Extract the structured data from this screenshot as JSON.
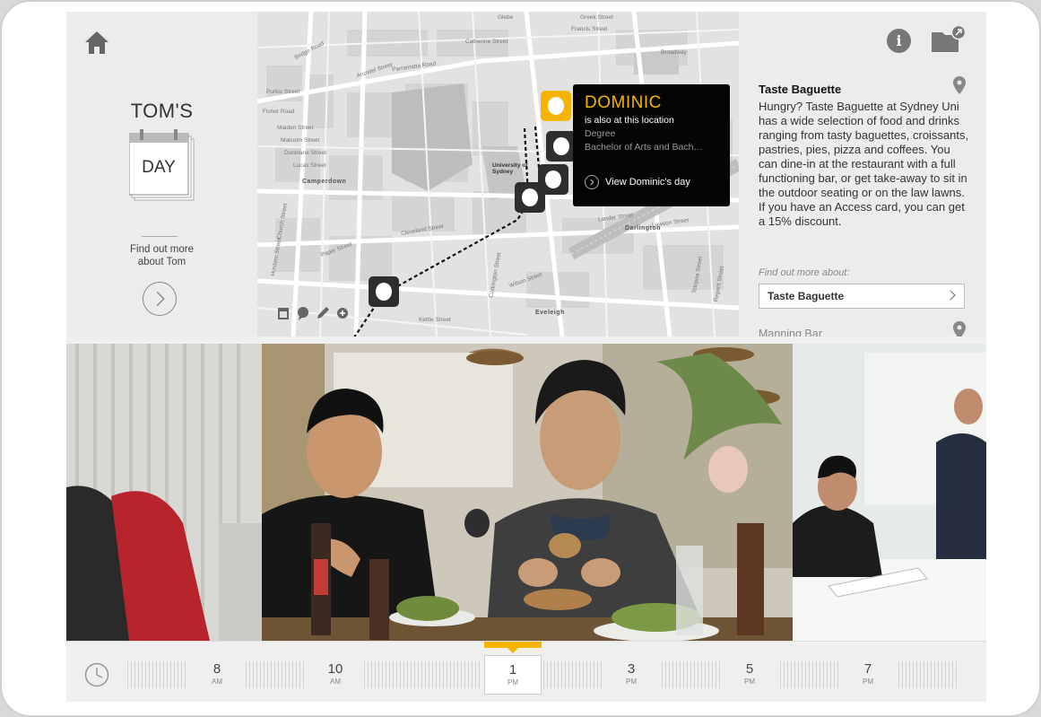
{
  "left_panel": {
    "title": "TOM'S",
    "calendar_label": "DAY",
    "find_more_line1": "Find out more",
    "find_more_line2": "about Tom"
  },
  "map": {
    "streets": [
      "Glebe",
      "Greek Street",
      "Francis Street",
      "Catherine Street",
      "Bridge Road",
      "Parramatta Road",
      "Broadway",
      "Arundel Street",
      "Purkis Street",
      "Fisher Road",
      "Maiden Street",
      "Malcolm Street",
      "Dunblane Street",
      "Lucas Street",
      "Church Street",
      "Hordern Street",
      "Paper Street",
      "Cleveland Street",
      "Lander Street",
      "Lawson Street",
      "Wilson Street",
      "Codrington Street",
      "Kettle Street",
      "Telopea Street",
      "Regent Street",
      "Eveleigh",
      "Darlington",
      "Camperdown",
      "University of Sydney"
    ],
    "tools": [
      "calendar-tool-icon",
      "chat-tool-icon",
      "pencil-tool-icon",
      "add-tool-icon"
    ]
  },
  "popup": {
    "name": "DOMINIC",
    "subtitle": "is also at this location",
    "degree_label": "Degree",
    "degree_value": "Bachelor of Arts and Bach…",
    "link_label": "View Dominic's day"
  },
  "right_panel": {
    "place_title": "Taste Baguette",
    "place_description": "Hungry? Taste Baguette at Sydney Uni has a wide selection of food and drinks ranging from tasty baguettes, croissants, pastries, pies, pizza and coffees. You can dine-in at the restaurant with a full functioning bar, or get take-away to sit in the outdoor seating or on the law lawns. If you have an Access card, you can get a 15% discount.",
    "find_about_label": "Find out more about:",
    "find_about_button": "Taste Baguette",
    "next_place": "Manning Bar"
  },
  "timeline": {
    "ticks": [
      {
        "hour": "8",
        "period": "AM"
      },
      {
        "hour": "10",
        "period": "AM"
      },
      {
        "hour": "1",
        "period": "PM"
      },
      {
        "hour": "3",
        "period": "PM"
      },
      {
        "hour": "5",
        "period": "PM"
      },
      {
        "hour": "7",
        "period": "PM"
      }
    ],
    "active_index": 2
  },
  "colors": {
    "accent": "#f5b400",
    "pin": "#2e2e2e",
    "popup_bg": "#050505"
  }
}
